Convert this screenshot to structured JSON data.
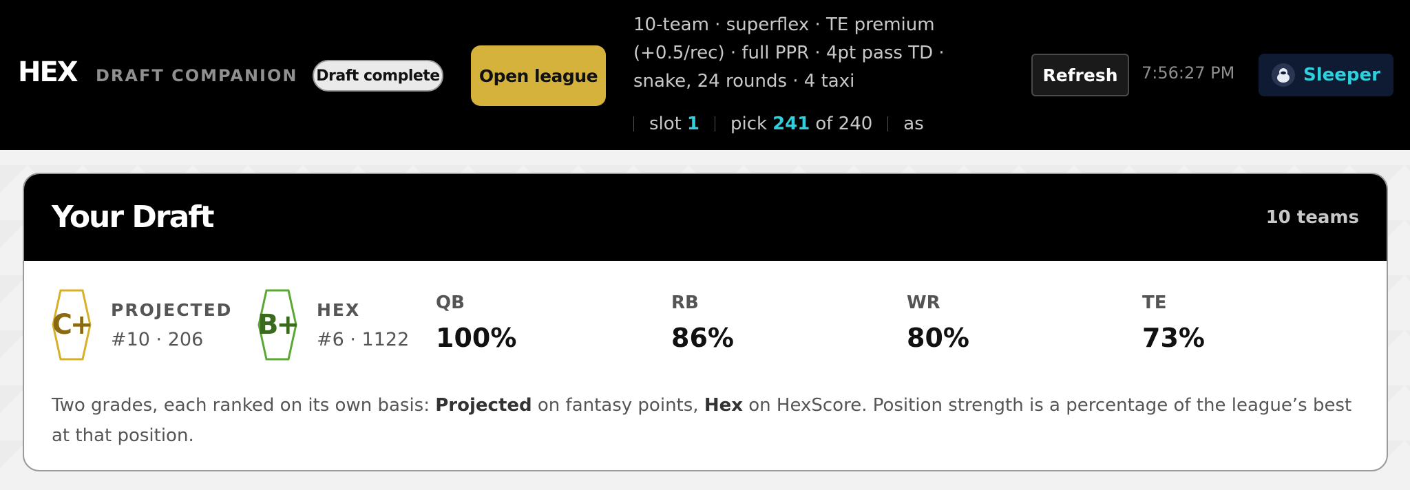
{
  "header": {
    "logo": "HEX",
    "subtitle": "DRAFT COMPANION",
    "status": "Draft complete",
    "open_league": "Open league",
    "settings": "10-team · superflex · TE premium (+0.5/rec) · full PPR · 4pt pass TD · snake, 24 rounds · 4 taxi",
    "slot_label": "slot",
    "slot_value": "1",
    "pick_label": "pick",
    "pick_value": "241",
    "pick_of": "of 240",
    "as_label": "as",
    "refresh": "Refresh",
    "time": "7:56:27 PM",
    "platform": "Sleeper"
  },
  "card": {
    "title": "Your Draft",
    "teams": "10 teams",
    "grades": [
      {
        "letter": "C+",
        "label": "PROJECTED",
        "detail": "#10 · 206",
        "color": "#d6b02a",
        "text_color": "#8a6a10"
      },
      {
        "letter": "B+",
        "label": "HEX",
        "detail": "#6 · 1122",
        "color": "#5aa832",
        "text_color": "#3a6a1e"
      }
    ],
    "positions": [
      {
        "label": "QB",
        "value": "100%"
      },
      {
        "label": "RB",
        "value": "86%"
      },
      {
        "label": "WR",
        "value": "80%"
      },
      {
        "label": "TE",
        "value": "73%"
      }
    ],
    "explain": {
      "p1": "Two grades, each ranked on its own basis: ",
      "b1": "Projected",
      "p2": " on fantasy points, ",
      "b2": "Hex",
      "p3": " on HexScore. Position strength is a percentage of the league’s best at that position."
    }
  }
}
